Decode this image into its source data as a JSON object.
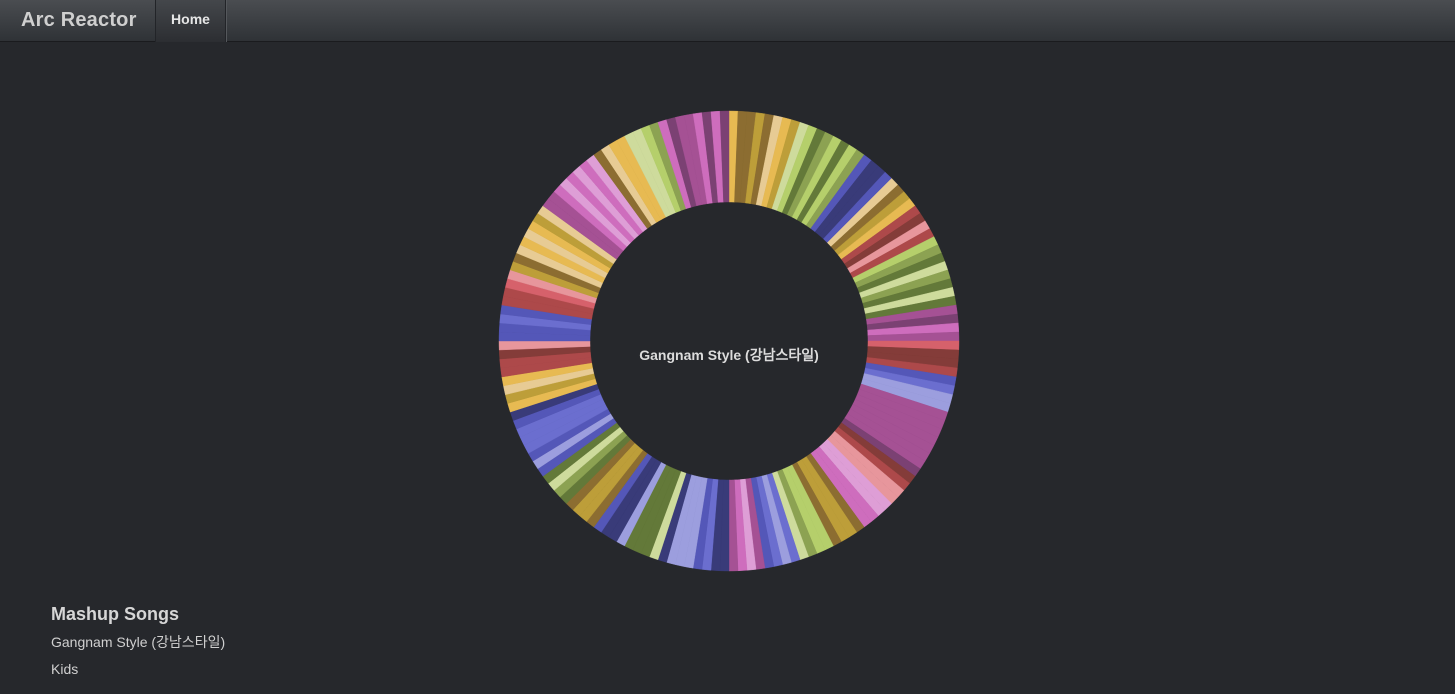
{
  "app": {
    "brand": "Arc Reactor",
    "nav": [
      {
        "label": "Home"
      }
    ]
  },
  "reactor": {
    "center_label": "Gangnam Style (강남스타일)",
    "segment_count": 160,
    "palette": [
      "#5457b8",
      "#6b6ecf",
      "#9c9ede",
      "#393b79",
      "#637939",
      "#8ca252",
      "#b5cf6b",
      "#cedb9c",
      "#8c6d31",
      "#bd9e39",
      "#e7ba52",
      "#e7cb94",
      "#843c39",
      "#ad494a",
      "#d6616b",
      "#e7969c",
      "#7b4173",
      "#a55194",
      "#ce6dbd",
      "#de9ed6"
    ]
  },
  "mashup": {
    "heading": "Mashup Songs",
    "songs": [
      {
        "title": "Gangnam Style (강남스타일)"
      },
      {
        "title": "Kids"
      }
    ]
  }
}
